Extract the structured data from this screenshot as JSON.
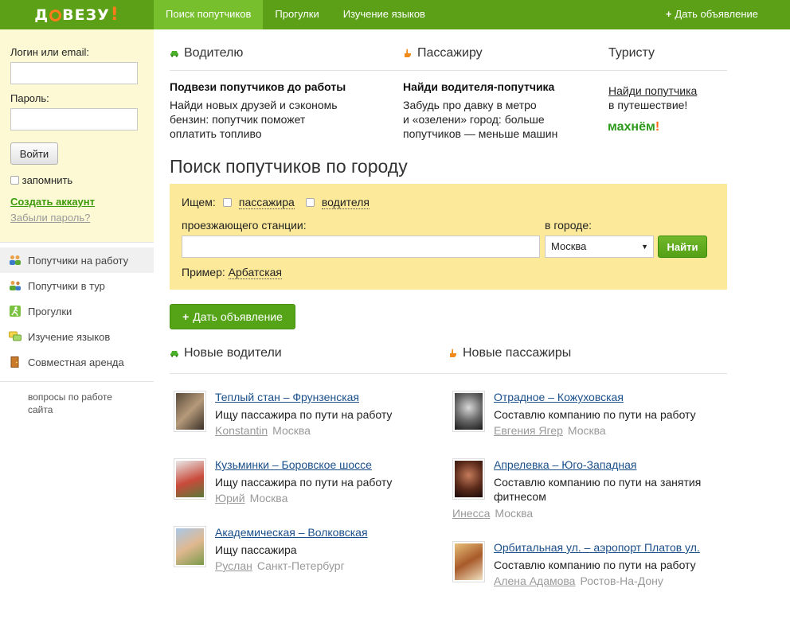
{
  "logo": {
    "pre": "Д",
    "post": "ВЕЗУ",
    "bang": "!"
  },
  "nav": [
    {
      "label": "Поиск попутчиков"
    },
    {
      "label": "Прогулки"
    },
    {
      "label": "Изучение языков"
    }
  ],
  "top_add": {
    "plus": "+",
    "label": "Дать объявление"
  },
  "login": {
    "login_label": "Логин или email:",
    "password_label": "Пароль:",
    "login_value": "",
    "password_value": "",
    "submit": "Войти",
    "remember": "запомнить",
    "create_account": "Создать аккаунт",
    "forgot": "Забыли пароль?"
  },
  "sidebar": {
    "items": [
      {
        "label": "Попутчики на работу"
      },
      {
        "label": "Попутчики в тур"
      },
      {
        "label": "Прогулки"
      },
      {
        "label": "Изучение языков"
      },
      {
        "label": "Совместная аренда"
      }
    ],
    "questions": "вопросы по работе сайта"
  },
  "columns": {
    "driver": {
      "head": "Водителю",
      "title": "Подвези попутчиков до работы",
      "text1": "Найди новых друзей и сэкономь",
      "text2": "бензин: попутчик поможет",
      "text3": "оплатить топливо"
    },
    "passenger": {
      "head": "Пассажиру",
      "title": "Найди водителя-попутчика",
      "text1": "Забудь про давку в метро",
      "text2": "и «озелени» город: больше",
      "text3": "попутчиков — меньше машин"
    },
    "tourist": {
      "head": "Туристу",
      "link": "Найди попутчика",
      "text": "в путешествие!",
      "brand": "махнём",
      "brand_bang": "!"
    }
  },
  "search": {
    "title": "Поиск попутчиков по городу",
    "looking": "Ищем:",
    "opt_passenger": "пассажира",
    "opt_driver": "водителя",
    "station_label": "проезжающего станции:",
    "station_value": "",
    "city_label": "в городе:",
    "city_value": "Москва",
    "find_button": "Найти",
    "example_label": "Пример:",
    "example_value": "Арбатская"
  },
  "add_button": {
    "plus": "+",
    "label": "Дать объявление"
  },
  "new_drivers": {
    "head": "Новые водители",
    "items": [
      {
        "route": "Теплый стан – Фрунзенская",
        "desc": "Ищу пассажира по пути на работу",
        "name": "Konstantin",
        "city": "Москва"
      },
      {
        "route": "Кузьминки – Боровское шоссе",
        "desc": "Ищу пассажира по пути на работу",
        "name": "Юрий",
        "city": "Москва"
      },
      {
        "route": "Академическая – Волковская",
        "desc": "Ищу пассажира",
        "name": "Руслан",
        "city": "Санкт-Петербург"
      }
    ]
  },
  "new_passengers": {
    "head": "Новые пассажиры",
    "items": [
      {
        "route": "Отрадное – Кожуховская",
        "desc": "Составлю компанию по пути на работу",
        "name": "Евгения Ягер",
        "city": "Москва"
      },
      {
        "route": "Апрелевка – Юго-Западная",
        "desc": "Составлю компанию по пути на занятия",
        "desc2": "фитнесом",
        "name": "Инесса",
        "city": "Москва"
      },
      {
        "route": "Орбитальная ул. – аэропорт Платов ул.",
        "desc": "Составлю компанию по пути на работу",
        "name": "Алена Адамова",
        "city": "Ростов-На-Дону"
      }
    ]
  },
  "colors": {
    "topbar": "#5ba016",
    "nav_active": "#77bf2c",
    "login_bg": "#fcf9d4",
    "search_bg": "#fce99a",
    "accent_orange": "#ff7a1a",
    "button_green": "#55a418"
  }
}
